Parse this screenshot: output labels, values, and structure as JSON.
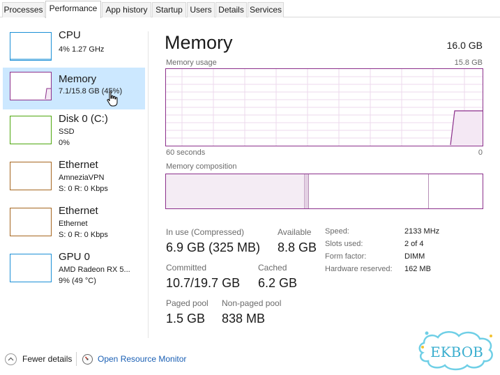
{
  "tabs": [
    {
      "label": "Processes",
      "active": false
    },
    {
      "label": "Performance",
      "active": true
    },
    {
      "label": "App history",
      "active": false
    },
    {
      "label": "Startup",
      "active": false
    },
    {
      "label": "Users",
      "active": false
    },
    {
      "label": "Details",
      "active": false
    },
    {
      "label": "Services",
      "active": false
    }
  ],
  "sidebar": {
    "items": [
      {
        "name": "CPU",
        "line1": "4%  1.27 GHz",
        "line2": "",
        "color": "#1a8fd6",
        "selected": false,
        "usage": 0.04
      },
      {
        "name": "Memory",
        "line1": "7.1/15.8 GB (45%)",
        "line2": "",
        "color": "#8b2f8b",
        "selected": true,
        "usage": 0.45
      },
      {
        "name": "Disk 0 (C:)",
        "line1": "SSD",
        "line2": "0%",
        "color": "#4da60c",
        "selected": false,
        "usage": 0
      },
      {
        "name": "Ethernet",
        "line1": "AmneziaVPN",
        "line2": "S: 0  R: 0 Kbps",
        "color": "#a5651e",
        "selected": false,
        "usage": 0
      },
      {
        "name": "Ethernet",
        "line1": "Ethernet",
        "line2": "S: 0  R: 0 Kbps",
        "color": "#a5651e",
        "selected": false,
        "usage": 0
      },
      {
        "name": "GPU 0",
        "line1": "AMD Radeon RX 5...",
        "line2": "9%  (49 °C)",
        "color": "#1a8fd6",
        "selected": false,
        "usage": 0.09
      }
    ]
  },
  "main": {
    "title": "Memory",
    "total": "16.0 GB",
    "usage_label": "Memory usage",
    "usage_max": "15.8 GB",
    "time_left": "60 seconds",
    "time_right": "0",
    "composition_label": "Memory composition",
    "accent": "#8b2f8b",
    "usage_fraction": 0.45
  },
  "stats": {
    "in_use_label": "In use (Compressed)",
    "in_use_value": "6.9 GB (325 MB)",
    "available_label": "Available",
    "available_value": "8.8 GB",
    "committed_label": "Committed",
    "committed_value": "10.7/19.7 GB",
    "cached_label": "Cached",
    "cached_value": "6.2 GB",
    "paged_label": "Paged pool",
    "paged_value": "1.5 GB",
    "nonpaged_label": "Non-paged pool",
    "nonpaged_value": "838 MB"
  },
  "specs": {
    "speed_label": "Speed:",
    "speed_value": "2133 MHz",
    "slots_label": "Slots used:",
    "slots_value": "2 of 4",
    "form_label": "Form factor:",
    "form_value": "DIMM",
    "reserved_label": "Hardware reserved:",
    "reserved_value": "162 MB"
  },
  "footer": {
    "fewer_details": "Fewer details",
    "open_resource_monitor": "Open Resource Monitor"
  },
  "watermark": {
    "text": "EKBOB"
  }
}
